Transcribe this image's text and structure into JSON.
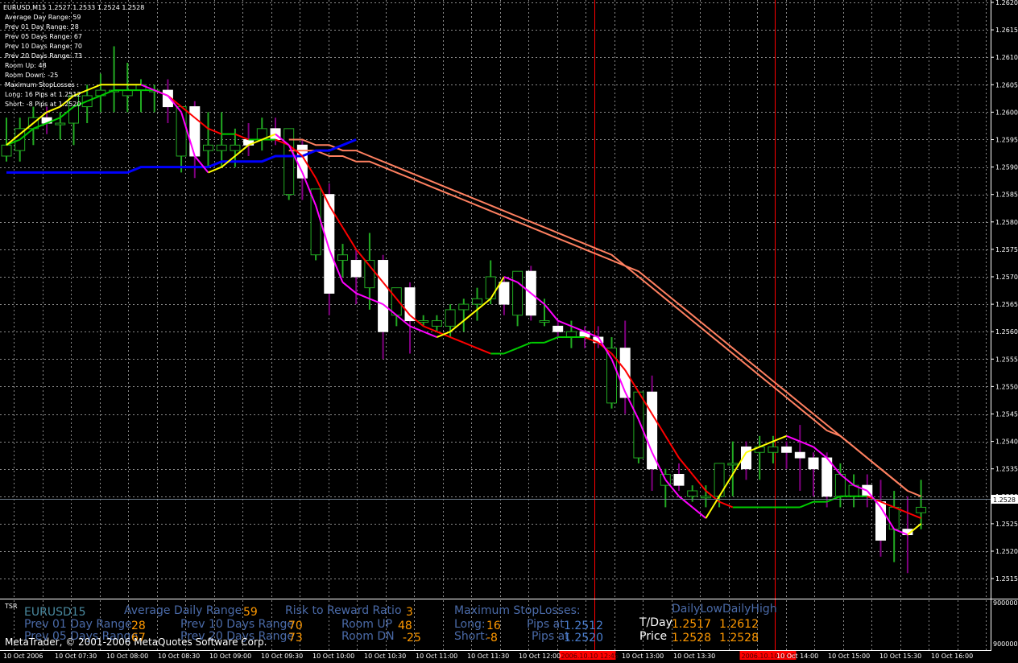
{
  "window": {
    "symbol_header": "EURUSD,M15  1.2527 1.2533 1.2524 1.2528",
    "copyright": "MetaTrader, © 2001-2006 MetaQuotes Software Corp."
  },
  "info_panel": [
    "Average Day  Range: 59",
    "Prev 01  Day  Range: 28",
    "Prev 05  Days Range: 67",
    "Prev 10  Days Range: 70",
    "Prev 20  Days Range: 73",
    "Room Up:    48",
    "Room Down: -25",
    "Maximum StopLosses :",
    "Long:  16 Pips at 1.2512",
    "Short: -8 Pips at 1.2520"
  ],
  "price_axis": {
    "labels": [
      "1.2620",
      "1.2615",
      "1.2610",
      "1.2605",
      "1.2600",
      "1.2595",
      "1.2590",
      "1.2585",
      "1.2580",
      "1.2575",
      "1.2570",
      "1.2565",
      "1.2560",
      "1.2555",
      "1.2550",
      "1.2545",
      "1.2540",
      "1.2535",
      "1.2530",
      "1.2525",
      "1.2520",
      "1.2515"
    ],
    "current_price": "1.2528"
  },
  "time_axis": {
    "labels": [
      "10 Oct 2006",
      "10 Oct 07:30",
      "10 Oct 08:00",
      "10 Oct 08:30",
      "10 Oct 09:00",
      "10 Oct 09:30",
      "10 Oct 10:00",
      "10 Oct 10:30",
      "10 Oct 11:00",
      "10 Oct 11:30",
      "10 Oct 12:00",
      "10 Oct 13:00",
      "10 Oct 13:30",
      "10 Oct 14:00",
      "10 Oct 15:00",
      "10 Oct 15:30",
      "10 Oct 16:00"
    ],
    "markers": [
      "2006.10.10 12:45",
      "2006.10.10 14:30"
    ]
  },
  "indicator": {
    "name": "TSR",
    "axis_labels": [
      "900000",
      "900000"
    ],
    "symbol": "EURUSD15",
    "avg_daily_range_label": "Average Daily Range",
    "avg_daily_range_value": "59",
    "prev01_label": "Prev 01 Day Range",
    "prev01_value": "28",
    "prev05_label": "Prev 05 Days Range",
    "prev05_value": "67",
    "prev10_label": "Prev 10 Days Range",
    "prev10_value": "70",
    "prev20_label": "Prev 20 Days Range",
    "prev20_value": "73",
    "risk_reward_label": "Risk to Reward Ratio",
    "risk_reward_value": "3",
    "room_up_label": "Room UP",
    "room_up_value": "48",
    "room_dn_label": "Room DN",
    "room_dn_value": "-25",
    "max_sl_label": "Maximum StopLosses:",
    "long_label": "Long:",
    "long_value": "16",
    "short_label": "Short:",
    "short_value": "-8",
    "pips_at_label": "Pips at",
    "long_price": "1.2512",
    "short_price": "1.2520",
    "daily_low_high_label": "DailyLowDailyHigh",
    "tday_label": "T/Day",
    "tday_low": "1.2517",
    "tday_high": "1.2612",
    "price_label": "Price",
    "price_value1": "1.2528",
    "price_value2": "1.2528"
  },
  "colors": {
    "background": "#000000",
    "grid": "#8a8a8a",
    "bull_candle": "#ffffff",
    "bear_candle": "#800080",
    "ma_fast_up": "#ffff00",
    "ma_fast_down": "#ff00ff",
    "ma_mid_up": "#00cc00",
    "ma_mid_down": "#ff0000",
    "ma_slow_blue": "#0000ff",
    "ma_salmon": "#ff8060",
    "marker_red": "#ff0000",
    "value_orange": "#ff9900",
    "value_blue": "#4a7ecf",
    "indicator_label_blue": "#4a6aa8",
    "symbol_teal": "#4a8aa0"
  },
  "chart_data": {
    "type": "candlestick",
    "timeframe": "M15",
    "candles": [
      {
        "o": 1.2592,
        "h": 1.2599,
        "l": 1.2591,
        "c": 1.2594
      },
      {
        "o": 1.2593,
        "h": 1.2599,
        "l": 1.2591,
        "c": 1.2597
      },
      {
        "o": 1.2597,
        "h": 1.2601,
        "l": 1.2594,
        "c": 1.2599
      },
      {
        "o": 1.2599,
        "h": 1.2601,
        "l": 1.2596,
        "c": 1.2598
      },
      {
        "o": 1.2598,
        "h": 1.26,
        "l": 1.2595,
        "c": 1.2598
      },
      {
        "o": 1.2598,
        "h": 1.2603,
        "l": 1.2594,
        "c": 1.2603
      },
      {
        "o": 1.2601,
        "h": 1.2605,
        "l": 1.2598,
        "c": 1.2603
      },
      {
        "o": 1.2603,
        "h": 1.2607,
        "l": 1.26,
        "c": 1.2604
      },
      {
        "o": 1.2604,
        "h": 1.2612,
        "l": 1.26,
        "c": 1.2604
      },
      {
        "o": 1.2603,
        "h": 1.2609,
        "l": 1.26,
        "c": 1.2604
      },
      {
        "o": 1.2604,
        "h": 1.2606,
        "l": 1.26,
        "c": 1.2605
      },
      {
        "o": 1.2604,
        "h": 1.2605,
        "l": 1.26,
        "c": 1.2604
      },
      {
        "o": 1.2604,
        "h": 1.2606,
        "l": 1.2598,
        "c": 1.2601
      },
      {
        "o": 1.2592,
        "h": 1.2601,
        "l": 1.2589,
        "c": 1.2601
      },
      {
        "o": 1.2601,
        "h": 1.2602,
        "l": 1.2588,
        "c": 1.2592
      },
      {
        "o": 1.2593,
        "h": 1.26,
        "l": 1.259,
        "c": 1.2594
      },
      {
        "o": 1.2593,
        "h": 1.26,
        "l": 1.259,
        "c": 1.2594
      },
      {
        "o": 1.2593,
        "h": 1.2597,
        "l": 1.259,
        "c": 1.2594
      },
      {
        "o": 1.2595,
        "h": 1.2598,
        "l": 1.2592,
        "c": 1.2594
      },
      {
        "o": 1.2595,
        "h": 1.2599,
        "l": 1.2593,
        "c": 1.2597
      },
      {
        "o": 1.2597,
        "h": 1.2599,
        "l": 1.2594,
        "c": 1.2595
      },
      {
        "o": 1.2585,
        "h": 1.2597,
        "l": 1.2584,
        "c": 1.2597
      },
      {
        "o": 1.2594,
        "h": 1.2595,
        "l": 1.2584,
        "c": 1.2588
      },
      {
        "o": 1.2574,
        "h": 1.2586,
        "l": 1.2573,
        "c": 1.2586
      },
      {
        "o": 1.2585,
        "h": 1.2587,
        "l": 1.2563,
        "c": 1.2567
      },
      {
        "o": 1.2573,
        "h": 1.2576,
        "l": 1.257,
        "c": 1.2574
      },
      {
        "o": 1.2573,
        "h": 1.2575,
        "l": 1.2565,
        "c": 1.257
      },
      {
        "o": 1.2568,
        "h": 1.2578,
        "l": 1.2564,
        "c": 1.2573
      },
      {
        "o": 1.2573,
        "h": 1.2574,
        "l": 1.2555,
        "c": 1.256
      },
      {
        "o": 1.2563,
        "h": 1.2568,
        "l": 1.2561,
        "c": 1.2568
      },
      {
        "o": 1.2568,
        "h": 1.2569,
        "l": 1.2556,
        "c": 1.2562
      },
      {
        "o": 1.2562,
        "h": 1.2563,
        "l": 1.2561,
        "c": 1.2562
      },
      {
        "o": 1.2561,
        "h": 1.2563,
        "l": 1.256,
        "c": 1.2562
      },
      {
        "o": 1.2561,
        "h": 1.2565,
        "l": 1.2559,
        "c": 1.2564
      },
      {
        "o": 1.2564,
        "h": 1.2566,
        "l": 1.256,
        "c": 1.2565
      },
      {
        "o": 1.2565,
        "h": 1.2568,
        "l": 1.2562,
        "c": 1.2566
      },
      {
        "o": 1.2566,
        "h": 1.2573,
        "l": 1.2565,
        "c": 1.257
      },
      {
        "o": 1.2569,
        "h": 1.257,
        "l": 1.2563,
        "c": 1.2565
      },
      {
        "o": 1.2563,
        "h": 1.2571,
        "l": 1.2561,
        "c": 1.2571
      },
      {
        "o": 1.2571,
        "h": 1.2572,
        "l": 1.2562,
        "c": 1.2563
      },
      {
        "o": 1.2562,
        "h": 1.2566,
        "l": 1.2561,
        "c": 1.2562
      },
      {
        "o": 1.2561,
        "h": 1.2562,
        "l": 1.2559,
        "c": 1.256
      },
      {
        "o": 1.2559,
        "h": 1.2562,
        "l": 1.2557,
        "c": 1.256
      },
      {
        "o": 1.256,
        "h": 1.2561,
        "l": 1.2557,
        "c": 1.2559
      },
      {
        "o": 1.2559,
        "h": 1.2561,
        "l": 1.2557,
        "c": 1.2558
      },
      {
        "o": 1.2547,
        "h": 1.2559,
        "l": 1.2546,
        "c": 1.2557
      },
      {
        "o": 1.2557,
        "h": 1.2562,
        "l": 1.2545,
        "c": 1.2548
      },
      {
        "o": 1.2537,
        "h": 1.2549,
        "l": 1.2536,
        "c": 1.2549
      },
      {
        "o": 1.2549,
        "h": 1.2552,
        "l": 1.2531,
        "c": 1.2535
      },
      {
        "o": 1.2532,
        "h": 1.2535,
        "l": 1.2528,
        "c": 1.2534
      },
      {
        "o": 1.2534,
        "h": 1.2536,
        "l": 1.2531,
        "c": 1.2532
      },
      {
        "o": 1.253,
        "h": 1.2532,
        "l": 1.2529,
        "c": 1.2531
      },
      {
        "o": 1.253,
        "h": 1.2532,
        "l": 1.2528,
        "c": 1.253
      },
      {
        "o": 1.253,
        "h": 1.2536,
        "l": 1.2528,
        "c": 1.2536
      },
      {
        "o": 1.2536,
        "h": 1.254,
        "l": 1.253,
        "c": 1.2536
      },
      {
        "o": 1.2539,
        "h": 1.254,
        "l": 1.2533,
        "c": 1.2535
      },
      {
        "o": 1.2538,
        "h": 1.2541,
        "l": 1.2533,
        "c": 1.2539
      },
      {
        "o": 1.2538,
        "h": 1.2541,
        "l": 1.2536,
        "c": 1.2539
      },
      {
        "o": 1.2539,
        "h": 1.254,
        "l": 1.2535,
        "c": 1.2538
      },
      {
        "o": 1.2538,
        "h": 1.2543,
        "l": 1.2531,
        "c": 1.2537
      },
      {
        "o": 1.2537,
        "h": 1.2538,
        "l": 1.253,
        "c": 1.2535
      },
      {
        "o": 1.2537,
        "h": 1.2538,
        "l": 1.2528,
        "c": 1.253
      },
      {
        "o": 1.253,
        "h": 1.2536,
        "l": 1.2528,
        "c": 1.2534
      },
      {
        "o": 1.253,
        "h": 1.2534,
        "l": 1.2528,
        "c": 1.2532
      },
      {
        "o": 1.2532,
        "h": 1.2534,
        "l": 1.2528,
        "c": 1.253
      },
      {
        "o": 1.2529,
        "h": 1.2533,
        "l": 1.2519,
        "c": 1.2522
      },
      {
        "o": 1.2524,
        "h": 1.2531,
        "l": 1.2518,
        "c": 1.2528
      },
      {
        "o": 1.2524,
        "h": 1.253,
        "l": 1.2516,
        "c": 1.2523
      },
      {
        "o": 1.2527,
        "h": 1.2533,
        "l": 1.2524,
        "c": 1.2528
      }
    ],
    "ma_fast": [
      1.2594,
      1.2596,
      1.2598,
      1.26,
      1.2601,
      1.2603,
      1.2604,
      1.2605,
      1.2605,
      1.2605,
      1.2605,
      1.2604,
      1.2603,
      1.26,
      1.2592,
      1.2589,
      1.259,
      1.2592,
      1.2594,
      1.2595,
      1.2596,
      1.2594,
      1.2589,
      1.2583,
      1.2575,
      1.2569,
      1.2567,
      1.2566,
      1.2565,
      1.2563,
      1.2561,
      1.256,
      1.2559,
      1.256,
      1.2562,
      1.2564,
      1.2566,
      1.257,
      1.2569,
      1.2567,
      1.2565,
      1.2562,
      1.2561,
      1.256,
      1.2559,
      1.2555,
      1.2549,
      1.2544,
      1.2538,
      1.2533,
      1.253,
      1.2528,
      1.2526,
      1.253,
      1.2534,
      1.2538,
      1.2539,
      1.254,
      1.2541,
      1.254,
      1.2539,
      1.2537,
      1.2534,
      1.2532,
      1.2531,
      1.2528,
      1.2524,
      1.2523,
      1.2525
    ],
    "ma_mid": [
      1.2594,
      1.2595,
      1.2597,
      1.2598,
      1.2599,
      1.2601,
      1.2602,
      1.2603,
      1.2604,
      1.2604,
      1.2604,
      1.2604,
      1.2603,
      1.2601,
      1.2599,
      1.2597,
      1.2596,
      1.2596,
      1.2595,
      1.2595,
      1.2595,
      1.2594,
      1.2592,
      1.2588,
      1.2583,
      1.2579,
      1.2575,
      1.2572,
      1.2569,
      1.2566,
      1.2563,
      1.2561,
      1.256,
      1.2559,
      1.2558,
      1.2557,
      1.2556,
      1.2556,
      1.2557,
      1.2558,
      1.2558,
      1.2559,
      1.2559,
      1.2559,
      1.2558,
      1.2556,
      1.2553,
      1.2549,
      1.2545,
      1.2541,
      1.2537,
      1.2534,
      1.2531,
      1.2529,
      1.2528,
      1.2528,
      1.2528,
      1.2528,
      1.2528,
      1.2528,
      1.2529,
      1.2529,
      1.253,
      1.253,
      1.253,
      1.2529,
      1.2528,
      1.2527,
      1.2526
    ],
    "ma_blue": [
      1.2589,
      1.2589,
      1.2589,
      1.2589,
      1.2589,
      1.2589,
      1.2589,
      1.2589,
      1.2589,
      1.2589,
      1.259,
      1.259,
      1.259,
      1.259,
      1.259,
      1.259,
      1.2591,
      1.2591,
      1.2591,
      1.2591,
      1.2592,
      1.2592,
      1.2592,
      1.2593,
      1.2593,
      1.2594,
      1.2595
    ],
    "ma_salmon1": [
      1.2595,
      1.2595,
      1.2594,
      1.2594,
      1.2593,
      1.2593,
      1.2592,
      1.2591,
      1.259,
      1.2589,
      1.2588,
      1.2587,
      1.2586,
      1.2585,
      1.2584,
      1.2583,
      1.2582,
      1.2581,
      1.258,
      1.2579,
      1.2578,
      1.2577,
      1.2576,
      1.2575,
      1.2574,
      1.2572,
      1.257,
      1.2568,
      1.2566,
      1.2564,
      1.2562,
      1.256,
      1.2558,
      1.2556,
      1.2554,
      1.2552,
      1.255,
      1.2548,
      1.2546,
      1.2544,
      1.2542,
      1.2541,
      1.2539,
      1.2537,
      1.2535,
      1.2533,
      1.2531
    ],
    "ma_salmon2": [
      1.2593,
      1.2593,
      1.2593,
      1.2592,
      1.2592,
      1.2591,
      1.2591,
      1.259,
      1.2589,
      1.2588,
      1.2587,
      1.2586,
      1.2585,
      1.2584,
      1.2583,
      1.2582,
      1.2581,
      1.258,
      1.2579,
      1.2578,
      1.2577,
      1.2576,
      1.2575,
      1.2574,
      1.2573,
      1.2572,
      1.2571,
      1.2569,
      1.2567,
      1.2565,
      1.2563,
      1.2561,
      1.2559,
      1.2557,
      1.2555,
      1.2553,
      1.2551,
      1.2549,
      1.2547,
      1.2545,
      1.2543,
      1.2541,
      1.2539,
      1.2537,
      1.2535,
      1.2533,
      1.2531,
      1.253
    ],
    "ylim": [
      1.2512,
      1.262
    ],
    "grid": true
  }
}
